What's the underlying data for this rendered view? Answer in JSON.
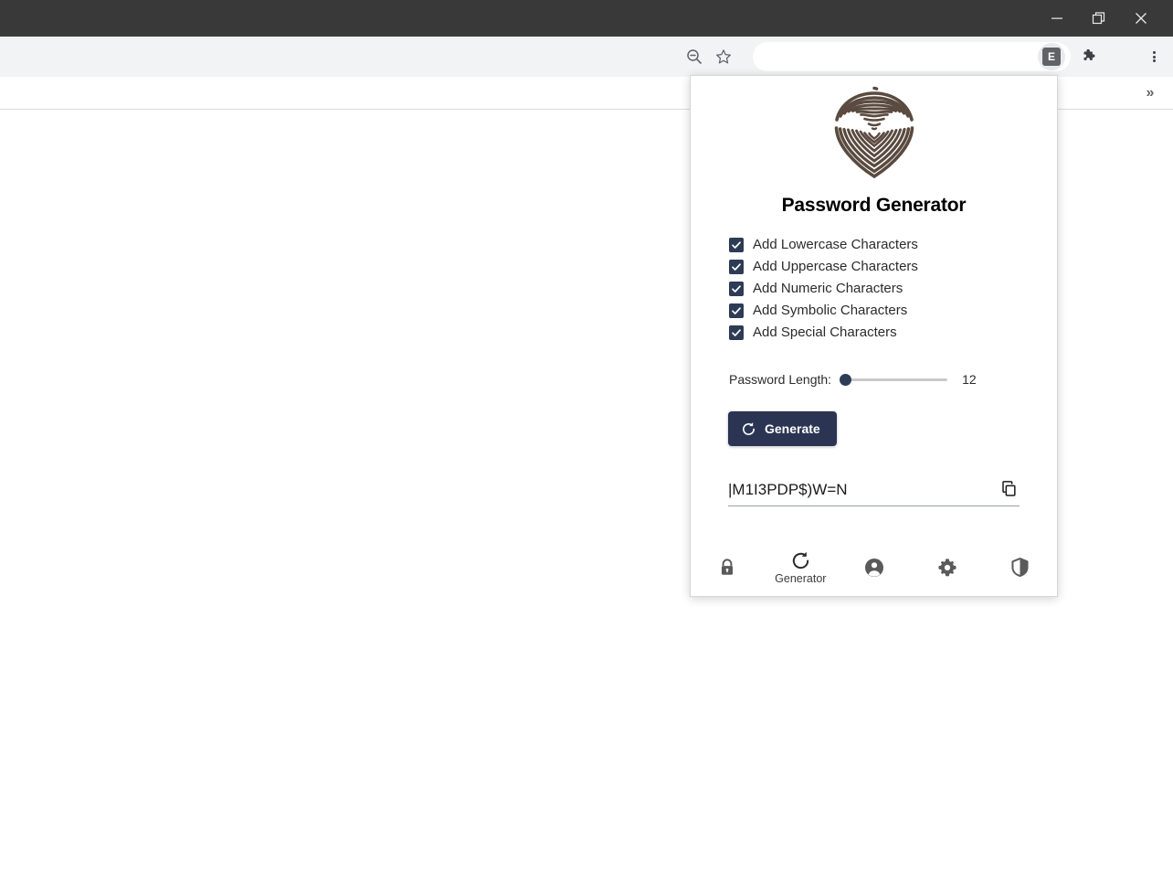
{
  "browser": {
    "window_controls": [
      {
        "name": "minimize",
        "glyph": "minimize-icon"
      },
      {
        "name": "maximize",
        "glyph": "restore-icon"
      },
      {
        "name": "close",
        "glyph": "close-icon"
      }
    ],
    "toolbar": {
      "zoom_out_icon": "zoom-out-icon",
      "bookmark_icon": "star-icon",
      "omnibox_value": "",
      "omnibox_placeholder": "",
      "extension_badge_letter": "E",
      "extensions_icon": "puzzle-piece-icon",
      "menu_icon": "three-dot-menu-icon"
    },
    "bookmarks_bar": {
      "overflow_label": "»"
    }
  },
  "popup": {
    "logo": "fingerprint-icon",
    "logo_color": "#5a4a3f",
    "title": "Password Generator",
    "accent_color": "#2b3553",
    "checkbox_color": "#2e3b55",
    "options": [
      {
        "label": "Add Lowercase Characters",
        "checked": true
      },
      {
        "label": "Add Uppercase Characters",
        "checked": true
      },
      {
        "label": "Add Numeric Characters",
        "checked": true
      },
      {
        "label": "Add Symbolic Characters",
        "checked": true
      },
      {
        "label": "Add Special Characters",
        "checked": true
      }
    ],
    "length": {
      "label": "Password Length:",
      "value": "12",
      "min": "12",
      "max": "64",
      "thumb_position_pct": 0
    },
    "generate_button": {
      "label": "Generate",
      "icon": "refresh-icon"
    },
    "password_output": {
      "value": "|M1I3PDP$)W=N",
      "copy_icon": "copy-icon"
    },
    "footer_nav": [
      {
        "name": "vault",
        "icon": "lock-icon",
        "label": "",
        "active": false
      },
      {
        "name": "generator",
        "icon": "refresh-icon",
        "label": "Generator",
        "active": true
      },
      {
        "name": "account",
        "icon": "account-circle-icon",
        "label": "",
        "active": false
      },
      {
        "name": "settings",
        "icon": "gear-icon",
        "label": "",
        "active": false
      },
      {
        "name": "security",
        "icon": "shield-icon",
        "label": "",
        "active": false
      }
    ]
  }
}
